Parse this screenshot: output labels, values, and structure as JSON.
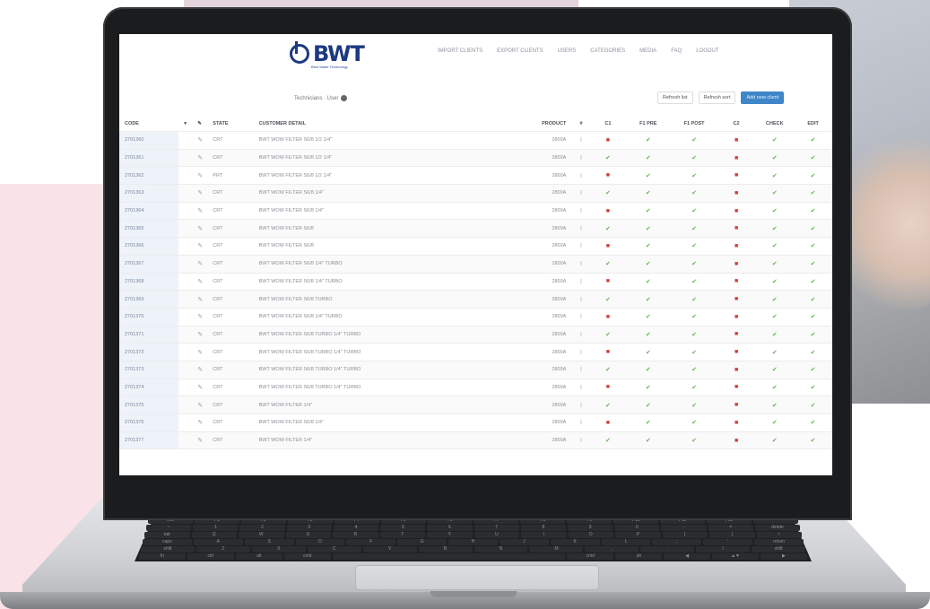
{
  "brand": {
    "name": "BWT",
    "tagline": "Best Water Technology"
  },
  "nav": [
    "IMPORT CLIENTS",
    "EXPORT CLIENTS",
    "USERS",
    "CATEGORIES",
    "MEDIA",
    "FAQ",
    "LOGOUT"
  ],
  "toolbar": {
    "view_label": "Technicians · User",
    "btn1": "Refresh list",
    "btn2": "Refresh sort",
    "btn3": "Add new client"
  },
  "table": {
    "headers": [
      "CODE",
      "",
      "",
      "STATE",
      "CUSTOMER DETAIL",
      "PRODUCT",
      "#",
      "C1",
      "F1 PRE",
      "F1 POST",
      "C2",
      "CHECK",
      "EDIT"
    ],
    "rows": [
      {
        "code": "2701360",
        "state": "CRT",
        "desc": "BWT WOW FILTER S6/8 1/2 1/4\"",
        "prod": "2800A",
        "marks": [
          "no",
          "ok",
          "ok",
          "no",
          "ok",
          "ok"
        ]
      },
      {
        "code": "2701361",
        "state": "CRT",
        "desc": "BWT WOW FILTER S6/8 1/2 1/4\"",
        "prod": "2800A",
        "marks": [
          "ok",
          "ok",
          "ok",
          "no",
          "ok",
          "ok"
        ]
      },
      {
        "code": "2701362",
        "state": "PRT",
        "desc": "BWT WOW FILTER S6/8 1/2 1/4\"",
        "prod": "2800A",
        "marks": [
          "no",
          "ok",
          "ok",
          "no",
          "ok",
          "ok"
        ]
      },
      {
        "code": "2701363",
        "state": "CRT",
        "desc": "BWT WOW FILTER S6/8 1/4\"",
        "prod": "2800A",
        "marks": [
          "ok",
          "ok",
          "ok",
          "no",
          "ok",
          "ok"
        ]
      },
      {
        "code": "2701364",
        "state": "CRT",
        "desc": "BWT WOW FILTER S6/8 1/4\"",
        "prod": "2800A",
        "marks": [
          "no",
          "ok",
          "ok",
          "no",
          "ok",
          "ok"
        ]
      },
      {
        "code": "2701365",
        "state": "CRT",
        "desc": "BWT WOW FILTER S6/8",
        "prod": "2800A",
        "marks": [
          "ok",
          "ok",
          "ok",
          "no",
          "ok",
          "ok"
        ]
      },
      {
        "code": "2701366",
        "state": "CRT",
        "desc": "BWT WOW FILTER S6/8",
        "prod": "2800A",
        "marks": [
          "no",
          "ok",
          "ok",
          "no",
          "ok",
          "ok"
        ]
      },
      {
        "code": "2701367",
        "state": "CRT",
        "desc": "BWT WOW FILTER S6/8 1/4\" TURBO",
        "prod": "2800A",
        "marks": [
          "ok",
          "ok",
          "ok",
          "no",
          "ok",
          "ok"
        ]
      },
      {
        "code": "2701368",
        "state": "CRT",
        "desc": "BWT WOW FILTER S6/8 1/4\" TURBO",
        "prod": "2800A",
        "marks": [
          "no",
          "ok",
          "ok",
          "no",
          "ok",
          "ok"
        ]
      },
      {
        "code": "2701369",
        "state": "CRT",
        "desc": "BWT WOW FILTER S6/8 TURBO",
        "prod": "2800A",
        "marks": [
          "ok",
          "ok",
          "ok",
          "no",
          "ok",
          "ok"
        ]
      },
      {
        "code": "2701370",
        "state": "CRT",
        "desc": "BWT WOW FILTER S6/8 1/4\" TURBO",
        "prod": "2800A",
        "marks": [
          "no",
          "ok",
          "ok",
          "no",
          "ok",
          "ok"
        ]
      },
      {
        "code": "2701371",
        "state": "CRT",
        "desc": "BWT WOW FILTER S6/8 TURBO 1/4\" TURBO",
        "prod": "2800A",
        "marks": [
          "ok",
          "ok",
          "ok",
          "no",
          "ok",
          "ok"
        ]
      },
      {
        "code": "2701372",
        "state": "CRT",
        "desc": "BWT WOW FILTER S6/8 TURBO 1/4\" TURBO",
        "prod": "2800A",
        "marks": [
          "no",
          "ok",
          "ok",
          "no",
          "ok",
          "ok"
        ]
      },
      {
        "code": "2701373",
        "state": "CRT",
        "desc": "BWT WOW FILTER S6/8 TURBO 1/4\" TURBO",
        "prod": "2800A",
        "marks": [
          "ok",
          "ok",
          "ok",
          "no",
          "ok",
          "ok"
        ]
      },
      {
        "code": "2701374",
        "state": "CRT",
        "desc": "BWT WOW FILTER S6/8 TURBO 1/4\" TURBO",
        "prod": "2800A",
        "marks": [
          "no",
          "ok",
          "ok",
          "no",
          "ok",
          "ok"
        ]
      },
      {
        "code": "2701375",
        "state": "CRT",
        "desc": "BWT WOW FILTER 1/4\"",
        "prod": "2800A",
        "marks": [
          "ok",
          "ok",
          "ok",
          "no",
          "ok",
          "ok"
        ]
      },
      {
        "code": "2701376",
        "state": "CRT",
        "desc": "BWT WOW FILTER S6/8 1/4\"",
        "prod": "2800A",
        "marks": [
          "no",
          "ok",
          "ok",
          "no",
          "ok",
          "ok"
        ]
      },
      {
        "code": "2701377",
        "state": "CRT",
        "desc": "BWT WOW FILTER 1/4\"",
        "prod": "2800A",
        "marks": [
          "ok",
          "ok",
          "ok",
          "no",
          "ok",
          "ok"
        ]
      }
    ]
  },
  "keyboard": {
    "row1": [
      "esc",
      "F1",
      "F2",
      "F3",
      "F4",
      "F5",
      "F6",
      "F7",
      "F8",
      "F9",
      "F10",
      "F11",
      "F12",
      ""
    ],
    "row2": [
      "~",
      "1",
      "2",
      "3",
      "4",
      "5",
      "6",
      "7",
      "8",
      "9",
      "0",
      "-",
      "=",
      "delete"
    ],
    "row3": [
      "tab",
      "Q",
      "W",
      "E",
      "R",
      "T",
      "Y",
      "U",
      "I",
      "O",
      "P",
      "[",
      "]",
      "\\"
    ],
    "row4": [
      "caps",
      "A",
      "S",
      "D",
      "F",
      "G",
      "H",
      "J",
      "K",
      "L",
      ";",
      "'",
      "return"
    ],
    "row5": [
      "shift",
      "Z",
      "X",
      "C",
      "V",
      "B",
      "N",
      "M",
      ",",
      ".",
      "/",
      "shift"
    ],
    "row6": [
      "fn",
      "ctrl",
      "alt",
      "cmd",
      "",
      "cmd",
      "alt",
      "◀",
      "▲▼",
      "▶"
    ]
  }
}
